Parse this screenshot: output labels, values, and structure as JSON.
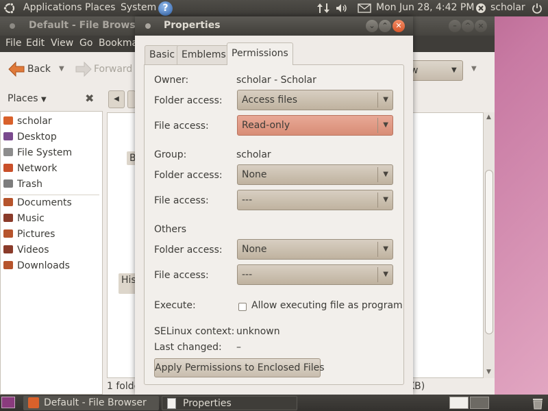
{
  "top_panel": {
    "menus": [
      "Applications",
      "Places",
      "System"
    ],
    "clock": "Mon Jun 28,  4:42 PM",
    "user": "scholar"
  },
  "file_browser": {
    "title": "Default - File Browser",
    "menu": [
      "File",
      "Edit",
      "View",
      "Go",
      "Bookma"
    ],
    "back_label": "Back",
    "forward_label": "Forward",
    "view_combo_fragment": "w",
    "places_label": "Places",
    "sidebar": [
      {
        "label": "scholar",
        "icon": "home-folder-icon",
        "color": "#d9612b"
      },
      {
        "label": "Desktop",
        "icon": "desktop-icon",
        "color": "#7a4a8e"
      },
      {
        "label": "File System",
        "icon": "harddisk-icon",
        "color": "#8d8d8d"
      },
      {
        "label": "Network",
        "icon": "network-icon",
        "color": "#c9502a"
      },
      {
        "label": "Trash",
        "icon": "trash-icon",
        "color": "#7d7d7d"
      },
      {
        "label": "Documents",
        "icon": "documents-folder-icon",
        "color": "#b6542c"
      },
      {
        "label": "Music",
        "icon": "music-folder-icon",
        "color": "#8a3b2a"
      },
      {
        "label": "Pictures",
        "icon": "pictures-folder-icon",
        "color": "#b6542c"
      },
      {
        "label": "Videos",
        "icon": "videos-folder-icon",
        "color": "#8a3b2a"
      },
      {
        "label": "Downloads",
        "icon": "downloads-folder-icon",
        "color": "#b6542c"
      }
    ],
    "content_fragments": [
      "B",
      "His"
    ],
    "status_left": "1 folde",
    "status_right": "KB)"
  },
  "properties": {
    "title": "Properties",
    "tabs": [
      "Basic",
      "Emblems",
      "Permissions"
    ],
    "active_tab": "Permissions",
    "owner_label": "Owner:",
    "owner_value": "scholar - Scholar",
    "owner_folder_label": "Folder access:",
    "owner_folder_value": "Access files",
    "owner_file_label": "File access:",
    "owner_file_value": "Read-only",
    "group_label": "Group:",
    "group_value": "scholar",
    "group_folder_label": "Folder access:",
    "group_folder_value": "None",
    "group_file_label": "File access:",
    "group_file_value": "---",
    "others_label": "Others",
    "others_folder_label": "Folder access:",
    "others_folder_value": "None",
    "others_file_label": "File access:",
    "others_file_value": "---",
    "execute_label": "Execute:",
    "execute_checkbox": "Allow executing file as program",
    "selinux_label": "SELinux context:",
    "selinux_value": "unknown",
    "last_changed_label": "Last changed:",
    "last_changed_value": "–",
    "apply_button": "Apply Permissions to Enclosed Files"
  },
  "taskbar": [
    {
      "label": "Default - File Browser",
      "icon": "file-browser-icon"
    },
    {
      "label": "Properties",
      "icon": "document-icon"
    }
  ]
}
